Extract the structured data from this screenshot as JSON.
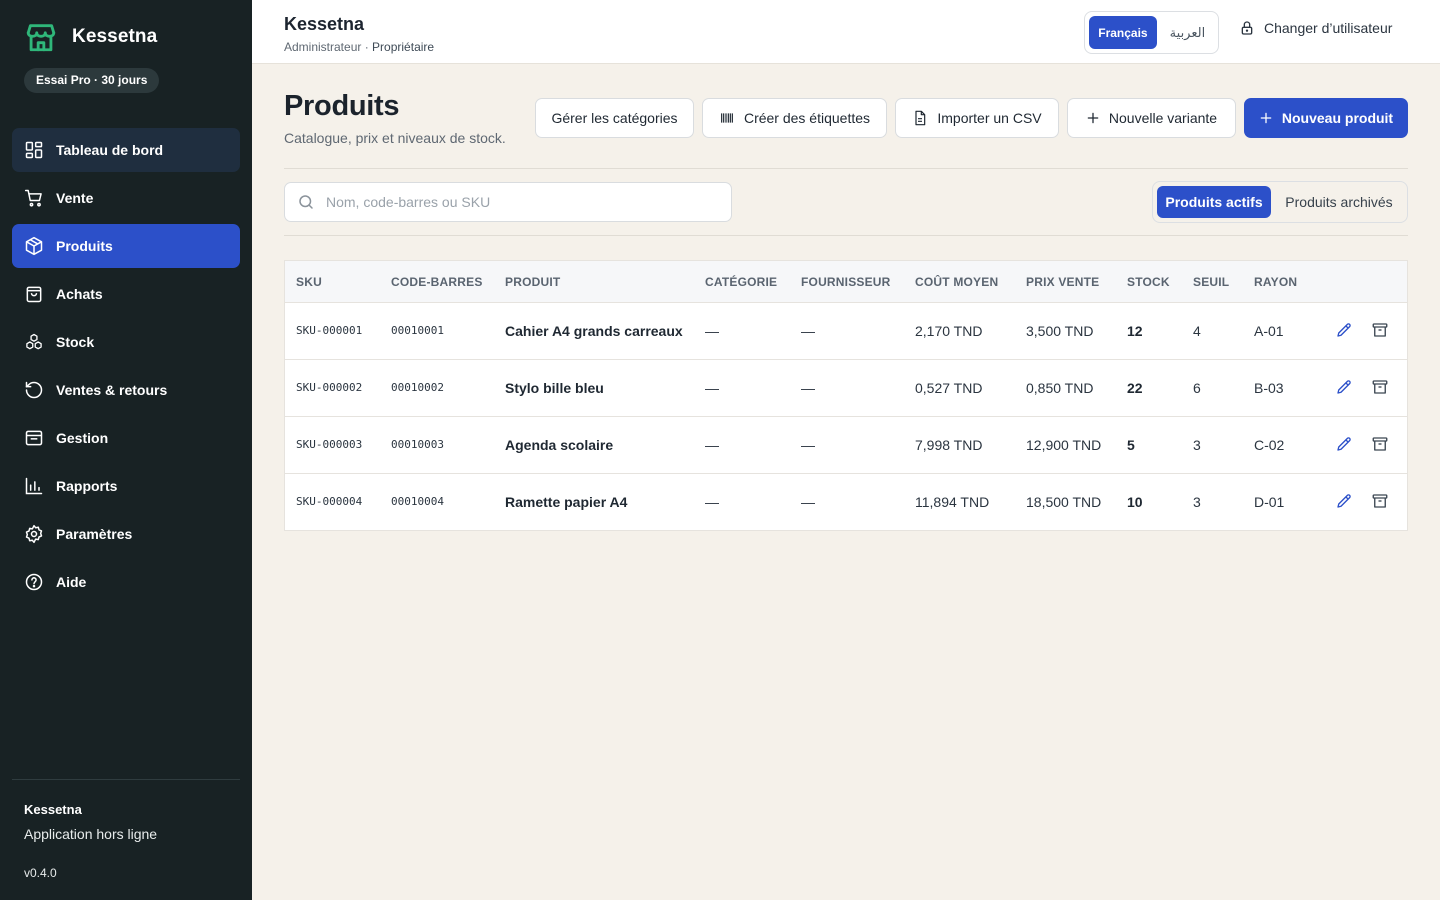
{
  "colors": {
    "accent": "#2c50c9",
    "sidebar_bg": "#182224",
    "page_bg": "#f5f1ea",
    "brand_icon": "#2fb77a"
  },
  "brand": {
    "name": "Kessetna",
    "trial": "Essai Pro · 30 jours",
    "icon": "store-icon"
  },
  "sidebar": {
    "items": [
      {
        "label": "Tableau de bord",
        "icon": "grid-icon"
      },
      {
        "label": "Vente",
        "icon": "cart-icon"
      },
      {
        "label": "Produits",
        "icon": "box-icon"
      },
      {
        "label": "Achats",
        "icon": "shopping-bag-icon"
      },
      {
        "label": "Stock",
        "icon": "boxes-icon"
      },
      {
        "label": "Ventes & retours",
        "icon": "history-icon"
      },
      {
        "label": "Gestion",
        "icon": "inbox-icon"
      },
      {
        "label": "Rapports",
        "icon": "bar-chart-icon"
      },
      {
        "label": "Paramètres",
        "icon": "gear-icon"
      },
      {
        "label": "Aide",
        "icon": "help-icon"
      }
    ],
    "footer": {
      "title": "Kessetna",
      "subtitle": "Application hors ligne",
      "version": "v0.4.0"
    }
  },
  "topbar": {
    "title": "Kessetna",
    "subtitle_user": "Administrateur",
    "subtitle_sep": " · ",
    "subtitle_role": "Propriétaire",
    "lang_fr": "Français",
    "lang_ar": "العربية",
    "switch_user": "Changer d’utilisateur"
  },
  "page": {
    "title": "Produits",
    "subtitle": "Catalogue, prix et niveaux de stock.",
    "actions": {
      "categories": "Gérer les catégories",
      "labels": "Créer des étiquettes",
      "import_csv": "Importer un CSV",
      "new_variant": "Nouvelle variante",
      "new_product": "Nouveau produit"
    },
    "search_placeholder": "Nom, code-barres ou SKU",
    "search_value": "",
    "tabs": {
      "active": "Produits actifs",
      "archived": "Produits archivés"
    }
  },
  "table": {
    "headers": {
      "sku": "SKU",
      "barcode": "CODE-BARRES",
      "product": "PRODUIT",
      "category": "CATÉGORIE",
      "supplier": "FOURNISSEUR",
      "avg_cost": "COÛT MOYEN",
      "price": "PRIX VENTE",
      "stock": "STOCK",
      "threshold": "SEUIL",
      "shelf": "RAYON"
    },
    "rows": [
      {
        "sku": "SKU-000001",
        "barcode": "00010001",
        "product": "Cahier A4 grands carreaux",
        "category": "—",
        "supplier": "—",
        "avg_cost": "2,170 TND",
        "price": "3,500 TND",
        "stock": "12",
        "threshold": "4",
        "shelf": "A-01"
      },
      {
        "sku": "SKU-000002",
        "barcode": "00010002",
        "product": "Stylo bille bleu",
        "category": "—",
        "supplier": "—",
        "avg_cost": "0,527 TND",
        "price": "0,850 TND",
        "stock": "22",
        "threshold": "6",
        "shelf": "B-03"
      },
      {
        "sku": "SKU-000003",
        "barcode": "00010003",
        "product": "Agenda scolaire",
        "category": "—",
        "supplier": "—",
        "avg_cost": "7,998 TND",
        "price": "12,900 TND",
        "stock": "5",
        "threshold": "3",
        "shelf": "C-02"
      },
      {
        "sku": "SKU-000004",
        "barcode": "00010004",
        "product": "Ramette papier A4",
        "category": "—",
        "supplier": "—",
        "avg_cost": "11,894 TND",
        "price": "18,500 TND",
        "stock": "10",
        "threshold": "3",
        "shelf": "D-01"
      }
    ]
  }
}
